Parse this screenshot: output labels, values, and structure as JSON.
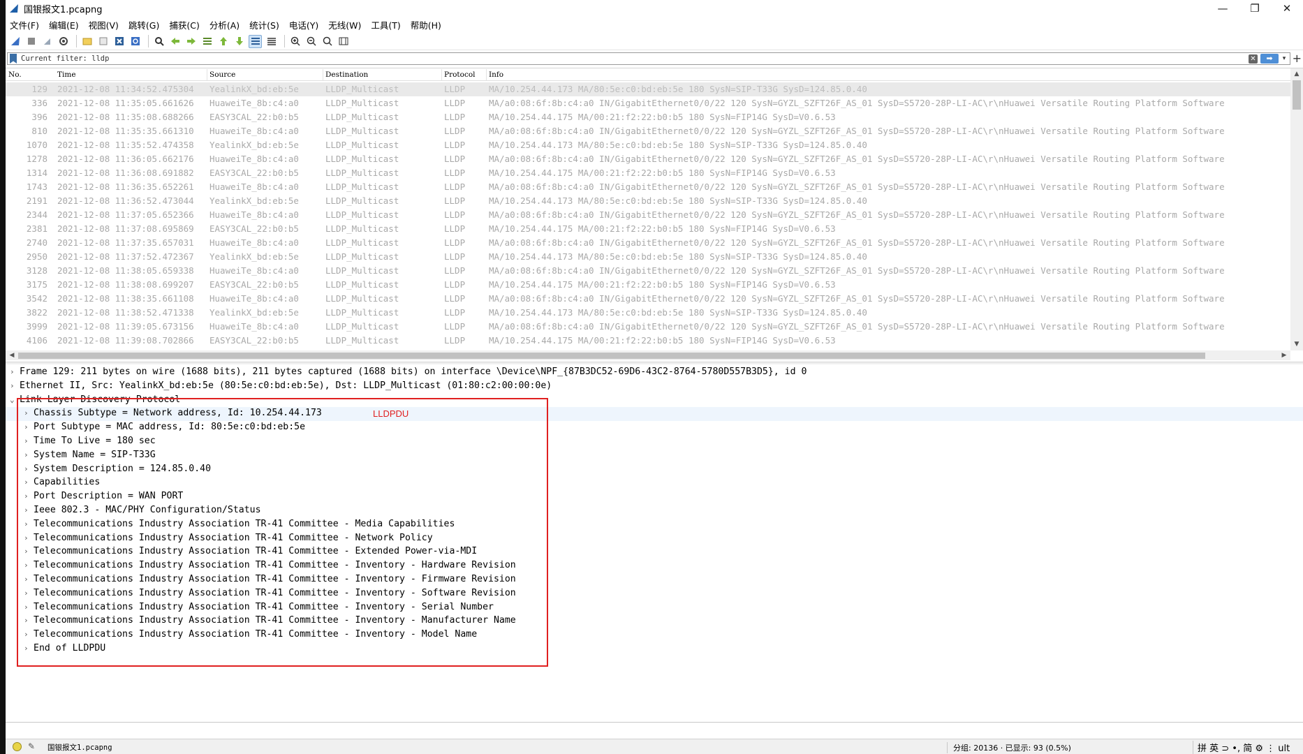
{
  "window": {
    "title": "国银报文1.pcapng",
    "controls": {
      "minimize": "—",
      "maximize": "❐",
      "close": "✕"
    }
  },
  "menu": [
    "文件(F)",
    "编辑(E)",
    "视图(V)",
    "跳转(G)",
    "捕获(C)",
    "分析(A)",
    "统计(S)",
    "电话(Y)",
    "无线(W)",
    "工具(T)",
    "帮助(H)"
  ],
  "toolbar": {
    "icons": [
      "shark-fin-start-icon",
      "stop-icon",
      "restart-icon",
      "options-gear-icon",
      "open-folder-icon",
      "save-icon",
      "close-file-icon",
      "reload-icon",
      "find-icon",
      "go-back-icon",
      "go-forward-icon",
      "go-to-packet-icon",
      "go-first-icon",
      "go-last-icon",
      "autoscroll-icon",
      "colorize-icon",
      "zoom-in-icon",
      "zoom-out-icon",
      "zoom-normal-icon",
      "resize-columns-icon"
    ]
  },
  "filter": {
    "text": "Current filter: lldp",
    "clear_icon": "✕",
    "apply_icon": "➡",
    "dropdown_icon": "▾",
    "add_icon": "+"
  },
  "packet_list": {
    "columns": [
      "No.",
      "Time",
      "Source",
      "Destination",
      "Protocol",
      "Info"
    ],
    "rows": [
      {
        "no": "129",
        "time": "2021-12-08 11:34:52.475304",
        "src": "YealinkX_bd:eb:5e",
        "dst": "LLDP_Multicast",
        "proto": "LLDP",
        "info": "MA/10.254.44.173 MA/80:5e:c0:bd:eb:5e 180 SysN=SIP-T33G SysD=124.85.0.40"
      },
      {
        "no": "336",
        "time": "2021-12-08 11:35:05.661626",
        "src": "HuaweiTe_8b:c4:a0",
        "dst": "LLDP_Multicast",
        "proto": "LLDP",
        "info": "MA/a0:08:6f:8b:c4:a0 IN/GigabitEthernet0/0/22 120 SysN=GYZL_SZFT26F_AS_01 SysD=S5720-28P-LI-AC\\r\\nHuawei Versatile Routing Platform Software"
      },
      {
        "no": "396",
        "time": "2021-12-08 11:35:08.688266",
        "src": "EASY3CAL_22:b0:b5",
        "dst": "LLDP_Multicast",
        "proto": "LLDP",
        "info": "MA/10.254.44.175 MA/00:21:f2:22:b0:b5 180 SysN=FIP14G SysD=V0.6.53"
      },
      {
        "no": "810",
        "time": "2021-12-08 11:35:35.661310",
        "src": "HuaweiTe_8b:c4:a0",
        "dst": "LLDP_Multicast",
        "proto": "LLDP",
        "info": "MA/a0:08:6f:8b:c4:a0 IN/GigabitEthernet0/0/22 120 SysN=GYZL_SZFT26F_AS_01 SysD=S5720-28P-LI-AC\\r\\nHuawei Versatile Routing Platform Software"
      },
      {
        "no": "1070",
        "time": "2021-12-08 11:35:52.474358",
        "src": "YealinkX_bd:eb:5e",
        "dst": "LLDP_Multicast",
        "proto": "LLDP",
        "info": "MA/10.254.44.173 MA/80:5e:c0:bd:eb:5e 180 SysN=SIP-T33G SysD=124.85.0.40"
      },
      {
        "no": "1278",
        "time": "2021-12-08 11:36:05.662176",
        "src": "HuaweiTe_8b:c4:a0",
        "dst": "LLDP_Multicast",
        "proto": "LLDP",
        "info": "MA/a0:08:6f:8b:c4:a0 IN/GigabitEthernet0/0/22 120 SysN=GYZL_SZFT26F_AS_01 SysD=S5720-28P-LI-AC\\r\\nHuawei Versatile Routing Platform Software"
      },
      {
        "no": "1314",
        "time": "2021-12-08 11:36:08.691882",
        "src": "EASY3CAL_22:b0:b5",
        "dst": "LLDP_Multicast",
        "proto": "LLDP",
        "info": "MA/10.254.44.175 MA/00:21:f2:22:b0:b5 180 SysN=FIP14G SysD=V0.6.53"
      },
      {
        "no": "1743",
        "time": "2021-12-08 11:36:35.652261",
        "src": "HuaweiTe_8b:c4:a0",
        "dst": "LLDP_Multicast",
        "proto": "LLDP",
        "info": "MA/a0:08:6f:8b:c4:a0 IN/GigabitEthernet0/0/22 120 SysN=GYZL_SZFT26F_AS_01 SysD=S5720-28P-LI-AC\\r\\nHuawei Versatile Routing Platform Software"
      },
      {
        "no": "2191",
        "time": "2021-12-08 11:36:52.473044",
        "src": "YealinkX_bd:eb:5e",
        "dst": "LLDP_Multicast",
        "proto": "LLDP",
        "info": "MA/10.254.44.173 MA/80:5e:c0:bd:eb:5e 180 SysN=SIP-T33G SysD=124.85.0.40"
      },
      {
        "no": "2344",
        "time": "2021-12-08 11:37:05.652366",
        "src": "HuaweiTe_8b:c4:a0",
        "dst": "LLDP_Multicast",
        "proto": "LLDP",
        "info": "MA/a0:08:6f:8b:c4:a0 IN/GigabitEthernet0/0/22 120 SysN=GYZL_SZFT26F_AS_01 SysD=S5720-28P-LI-AC\\r\\nHuawei Versatile Routing Platform Software"
      },
      {
        "no": "2381",
        "time": "2021-12-08 11:37:08.695869",
        "src": "EASY3CAL_22:b0:b5",
        "dst": "LLDP_Multicast",
        "proto": "LLDP",
        "info": "MA/10.254.44.175 MA/00:21:f2:22:b0:b5 180 SysN=FIP14G SysD=V0.6.53"
      },
      {
        "no": "2740",
        "time": "2021-12-08 11:37:35.657031",
        "src": "HuaweiTe_8b:c4:a0",
        "dst": "LLDP_Multicast",
        "proto": "LLDP",
        "info": "MA/a0:08:6f:8b:c4:a0 IN/GigabitEthernet0/0/22 120 SysN=GYZL_SZFT26F_AS_01 SysD=S5720-28P-LI-AC\\r\\nHuawei Versatile Routing Platform Software"
      },
      {
        "no": "2950",
        "time": "2021-12-08 11:37:52.472367",
        "src": "YealinkX_bd:eb:5e",
        "dst": "LLDP_Multicast",
        "proto": "LLDP",
        "info": "MA/10.254.44.173 MA/80:5e:c0:bd:eb:5e 180 SysN=SIP-T33G SysD=124.85.0.40"
      },
      {
        "no": "3128",
        "time": "2021-12-08 11:38:05.659338",
        "src": "HuaweiTe_8b:c4:a0",
        "dst": "LLDP_Multicast",
        "proto": "LLDP",
        "info": "MA/a0:08:6f:8b:c4:a0 IN/GigabitEthernet0/0/22 120 SysN=GYZL_SZFT26F_AS_01 SysD=S5720-28P-LI-AC\\r\\nHuawei Versatile Routing Platform Software"
      },
      {
        "no": "3175",
        "time": "2021-12-08 11:38:08.699207",
        "src": "EASY3CAL_22:b0:b5",
        "dst": "LLDP_Multicast",
        "proto": "LLDP",
        "info": "MA/10.254.44.175 MA/00:21:f2:22:b0:b5 180 SysN=FIP14G SysD=V0.6.53"
      },
      {
        "no": "3542",
        "time": "2021-12-08 11:38:35.661108",
        "src": "HuaweiTe_8b:c4:a0",
        "dst": "LLDP_Multicast",
        "proto": "LLDP",
        "info": "MA/a0:08:6f:8b:c4:a0 IN/GigabitEthernet0/0/22 120 SysN=GYZL_SZFT26F_AS_01 SysD=S5720-28P-LI-AC\\r\\nHuawei Versatile Routing Platform Software"
      },
      {
        "no": "3822",
        "time": "2021-12-08 11:38:52.471338",
        "src": "YealinkX_bd:eb:5e",
        "dst": "LLDP_Multicast",
        "proto": "LLDP",
        "info": "MA/10.254.44.173 MA/80:5e:c0:bd:eb:5e 180 SysN=SIP-T33G SysD=124.85.0.40"
      },
      {
        "no": "3999",
        "time": "2021-12-08 11:39:05.673156",
        "src": "HuaweiTe_8b:c4:a0",
        "dst": "LLDP_Multicast",
        "proto": "LLDP",
        "info": "MA/a0:08:6f:8b:c4:a0 IN/GigabitEthernet0/0/22 120 SysN=GYZL_SZFT26F_AS_01 SysD=S5720-28P-LI-AC\\r\\nHuawei Versatile Routing Platform Software"
      },
      {
        "no": "4106",
        "time": "2021-12-08 11:39:08.702866",
        "src": "EASY3CAL_22:b0:b5",
        "dst": "LLDP_Multicast",
        "proto": "LLDP",
        "info": "MA/10.254.44.175 MA/00:21:f2:22:b0:b5 180 SysN=FIP14G SysD=V0.6.53"
      }
    ],
    "selected_index": 0
  },
  "details": {
    "top": [
      "Frame 129: 211 bytes on wire (1688 bits), 211 bytes captured (1688 bits) on interface \\Device\\NPF_{87B3DC52-69D6-43C2-8764-5780D557B3D5}, id 0",
      "Ethernet II, Src: YealinkX_bd:eb:5e (80:5e:c0:bd:eb:5e), Dst: LLDP_Multicast (01:80:c2:00:00:0e)"
    ],
    "lldp_title": "Link Layer Discovery Protocol",
    "lldp_children": [
      "Chassis Subtype = Network address, Id: 10.254.44.173",
      "Port Subtype = MAC address, Id: 80:5e:c0:bd:eb:5e",
      "Time To Live = 180 sec",
      "System Name = SIP-T33G",
      "System Description = 124.85.0.40",
      "Capabilities",
      "Port Description = WAN PORT",
      "Ieee 802.3 - MAC/PHY Configuration/Status",
      "Telecommunications Industry Association TR-41 Committee - Media Capabilities",
      "Telecommunications Industry Association TR-41 Committee - Network Policy",
      "Telecommunications Industry Association TR-41 Committee - Extended Power-via-MDI",
      "Telecommunications Industry Association TR-41 Committee - Inventory - Hardware Revision",
      "Telecommunications Industry Association TR-41 Committee - Inventory - Firmware Revision",
      "Telecommunications Industry Association TR-41 Committee - Inventory - Software Revision",
      "Telecommunications Industry Association TR-41 Committee - Inventory - Serial Number",
      "Telecommunications Industry Association TR-41 Committee - Inventory - Manufacturer Name",
      "Telecommunications Industry Association TR-41 Committee - Inventory - Model Name",
      "End of LLDPDU"
    ],
    "highlighted_child": 0,
    "annotation_label": "LLDPDU",
    "annotation_color": "#e02020"
  },
  "status": {
    "file": "国银报文1.pcapng",
    "counts": "分组: 20136 · 已显示: 93 (0.5%)",
    "ime": "拼 英 ⊃ •, 简 ⚙ ⋮ ult"
  }
}
